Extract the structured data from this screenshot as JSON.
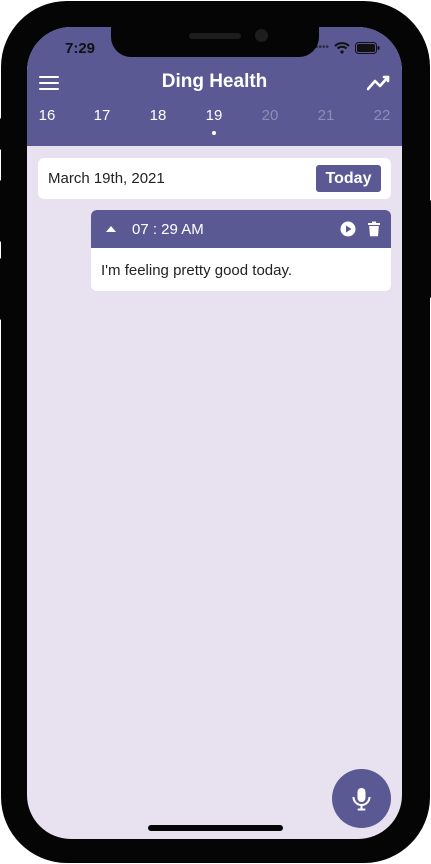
{
  "status_bar": {
    "time": "7:29",
    "icons": [
      "cellular-dots-icon",
      "wifi-icon",
      "battery-icon"
    ]
  },
  "header": {
    "title": "Ding Health",
    "menu_icon": "hamburger-menu-icon",
    "trend_icon": "trend-line-icon",
    "background_color": "#5b5993"
  },
  "days": [
    {
      "label": "16",
      "state": "past"
    },
    {
      "label": "17",
      "state": "past"
    },
    {
      "label": "18",
      "state": "past"
    },
    {
      "label": "19",
      "state": "selected"
    },
    {
      "label": "20",
      "state": "future"
    },
    {
      "label": "21",
      "state": "future"
    },
    {
      "label": "22",
      "state": "future"
    }
  ],
  "date_bar": {
    "date": "March 19th, 2021",
    "today_label": "Today"
  },
  "entries": [
    {
      "time": "07 : 29 AM",
      "text": "I'm feeling pretty good today.",
      "icons": [
        "caret-up-icon",
        "play-circle-icon",
        "trash-icon"
      ]
    }
  ],
  "mic_button": {
    "icon": "microphone-icon"
  },
  "colors": {
    "accent": "#5b5993",
    "background": "#e8e1ef",
    "future_day": "#8e8cb7",
    "card": "#ffffff"
  }
}
